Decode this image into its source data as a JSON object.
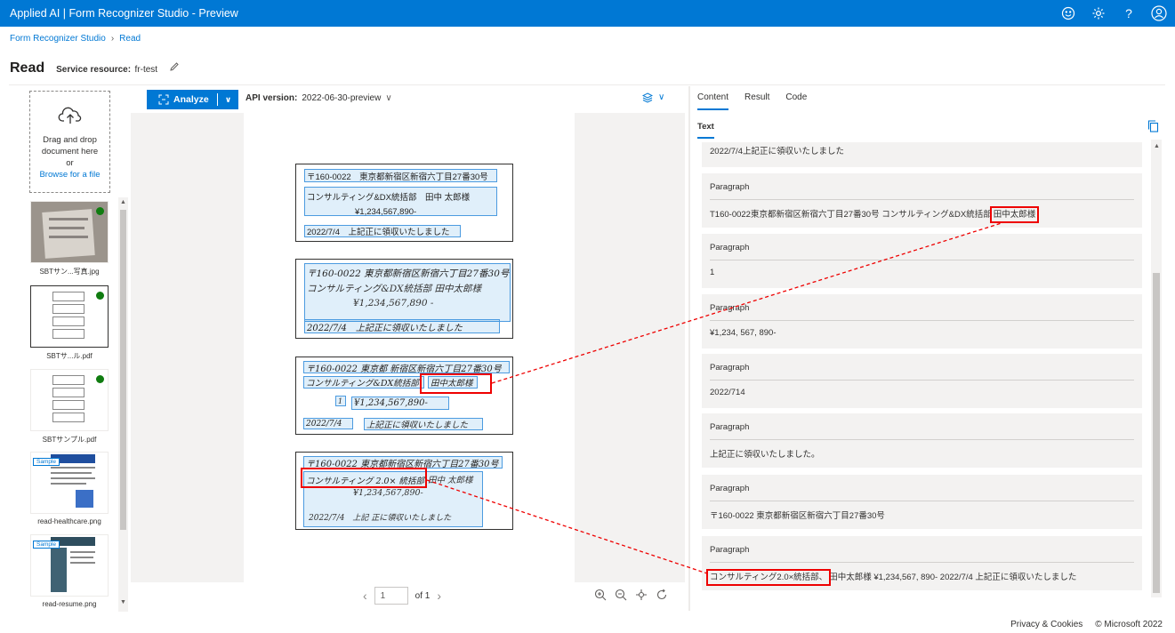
{
  "app": {
    "title": "Applied AI | Form Recognizer Studio - Preview",
    "brand_color": "#0078d4"
  },
  "topbar_icons": [
    "smiley-icon",
    "gear-icon",
    "help-icon",
    "account-icon"
  ],
  "help_glyph": "?",
  "breadcrumb": {
    "root": "Form Recognizer Studio",
    "current": "Read"
  },
  "page": {
    "title": "Read",
    "resource_label": "Service resource:",
    "resource_value": "fr-test"
  },
  "dropzone": {
    "line1": "Drag and drop",
    "line2": "document here",
    "line3": "or",
    "browse": "Browse for a file"
  },
  "files": [
    {
      "name": "SBTサン...写真.jpg"
    },
    {
      "name": "SBTサ...ル.pdf"
    },
    {
      "name": "SBTサンプル.pdf"
    },
    {
      "name": "read-healthcare.png",
      "tag": "Sample"
    },
    {
      "name": "read-resume.png",
      "tag": "Sample"
    }
  ],
  "toolbar": {
    "analyze_label": "Analyze",
    "api_label": "API version:",
    "api_value": "2022-06-30-preview"
  },
  "document": {
    "card1": {
      "line1": "〒160-0022　東京都新宿区新宿六丁目27番30号",
      "line2": "コンサルティング&DX統括部　田中 太郎様",
      "line3": "¥1,234,567,890-",
      "line4": "2022/7/4　上記正に領収いたしました"
    },
    "card2": {
      "line1": "〒160-0022 東京都新宿区新宿六丁目27番30号",
      "line2": "コンサルティング&DX統括部 田中太郎様",
      "line3": "¥1,234,567,890 -",
      "line4": "2022/7/4　上記正に領収いたしました"
    },
    "card3": {
      "line1": "〒160-0022 東京都 新宿区新宿六丁目27番30号",
      "line2": "コンサルティング&DX統括部",
      "line2b": "田中太郎様",
      "mark": "1",
      "line3": "¥1,234,567,890-",
      "date": "2022/7/4",
      "line4": "上記正に領収いたしました"
    },
    "card4": {
      "line1": "〒160-0022 東京都新宿区新宿六丁目27番30号",
      "line2": "コンサルティング 2.0× 統括部",
      "line2b": "田中 太郎様",
      "line3": "¥1,234,567,890-",
      "line4": "2022/7/4　上記 正に領収いたしました"
    }
  },
  "pager": {
    "page": "1",
    "of": "of 1"
  },
  "tabs": [
    "Content",
    "Result",
    "Code"
  ],
  "subtab": "Text",
  "results": [
    {
      "title": "",
      "text": "2022/7/4上記正に領収いたしました"
    },
    {
      "title": "Paragraph",
      "text": "T160-0022東京都新宿区新宿六丁目27番30号 コンサルティング&DX統括部",
      "highlight": "田中太郎様"
    },
    {
      "title": "Paragraph",
      "text": "1"
    },
    {
      "title": "Paragraph",
      "text": "¥1,234, 567, 890-"
    },
    {
      "title": "Paragraph",
      "text": "2022/714"
    },
    {
      "title": "Paragraph",
      "text": "上記正に領収いたしました。"
    },
    {
      "title": "Paragraph",
      "text": "〒160-0022 東京都新宿区新宿六丁目27番30号"
    },
    {
      "title": "Paragraph",
      "highlight": "コンサルティング2.0×統括部、",
      "text": "田中太郎様 ¥1,234,567, 890- 2022/7/4 上記正に領収いたしました"
    }
  ],
  "footer": {
    "privacy": "Privacy & Cookies",
    "copyright": "© Microsoft 2022"
  }
}
